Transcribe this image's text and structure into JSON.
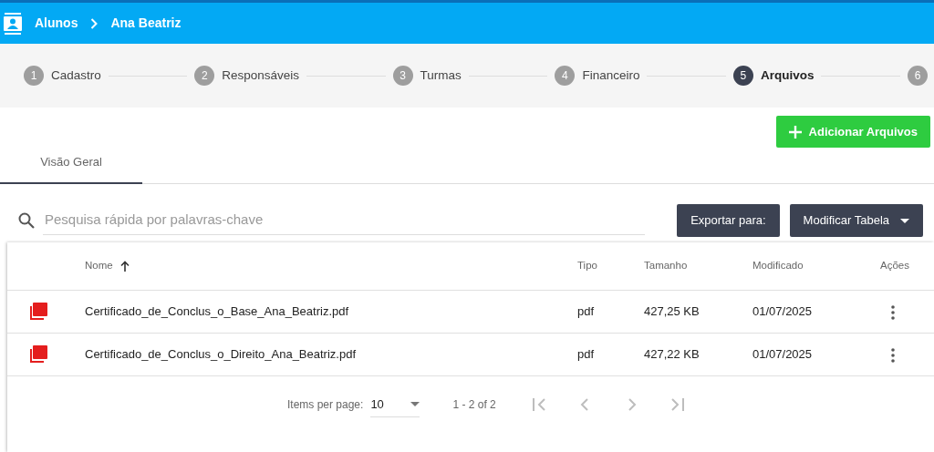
{
  "breadcrumb": [
    {
      "label": "Alunos"
    },
    {
      "label": "Ana Beatriz"
    }
  ],
  "steps": [
    {
      "number": "1",
      "label": "Cadastro",
      "selected": false
    },
    {
      "number": "2",
      "label": "Responsáveis",
      "selected": false
    },
    {
      "number": "3",
      "label": "Turmas",
      "selected": false
    },
    {
      "number": "4",
      "label": "Financeiro",
      "selected": false
    },
    {
      "number": "5",
      "label": "Arquivos",
      "selected": true
    },
    {
      "number": "6",
      "selected": false
    }
  ],
  "add_button": {
    "label": "Adicionar Arquivos"
  },
  "tabs": [
    {
      "label": "Visão Geral",
      "selected": true
    }
  ],
  "search": {
    "placeholder": "Pesquisa rápida por palavras-chave"
  },
  "export_button": {
    "label": "Exportar para:"
  },
  "modify_button": {
    "label": "Modificar Tabela"
  },
  "table": {
    "columns": [
      {
        "label": "Nome",
        "sorted": true
      },
      {
        "label": "Tipo",
        "sorted": false
      },
      {
        "label": "Tamanho",
        "sorted": false
      },
      {
        "label": "Modificado",
        "sorted": false
      },
      {
        "label": "Ações",
        "sorted": false
      }
    ],
    "rows": [
      {
        "name": "Certificado_de_Conclus_o_Base_Ana_Beatriz.pdf",
        "type": "pdf",
        "size": "427,25 KB",
        "modified": "01/07/2025"
      },
      {
        "name": "Certificado_de_Conclus_o_Direito_Ana_Beatriz.pdf",
        "type": "pdf",
        "size": "427,22 KB",
        "modified": "01/07/2025"
      }
    ]
  },
  "pagination": {
    "items_per_page_label": "Items per page:",
    "items_per_page": "10",
    "range": "1 - 2 of 2",
    "buttons": [
      {
        "kind": "first",
        "disabled": true
      },
      {
        "kind": "prev",
        "disabled": true
      },
      {
        "kind": "next",
        "disabled": true
      },
      {
        "kind": "last",
        "disabled": true
      }
    ]
  }
}
